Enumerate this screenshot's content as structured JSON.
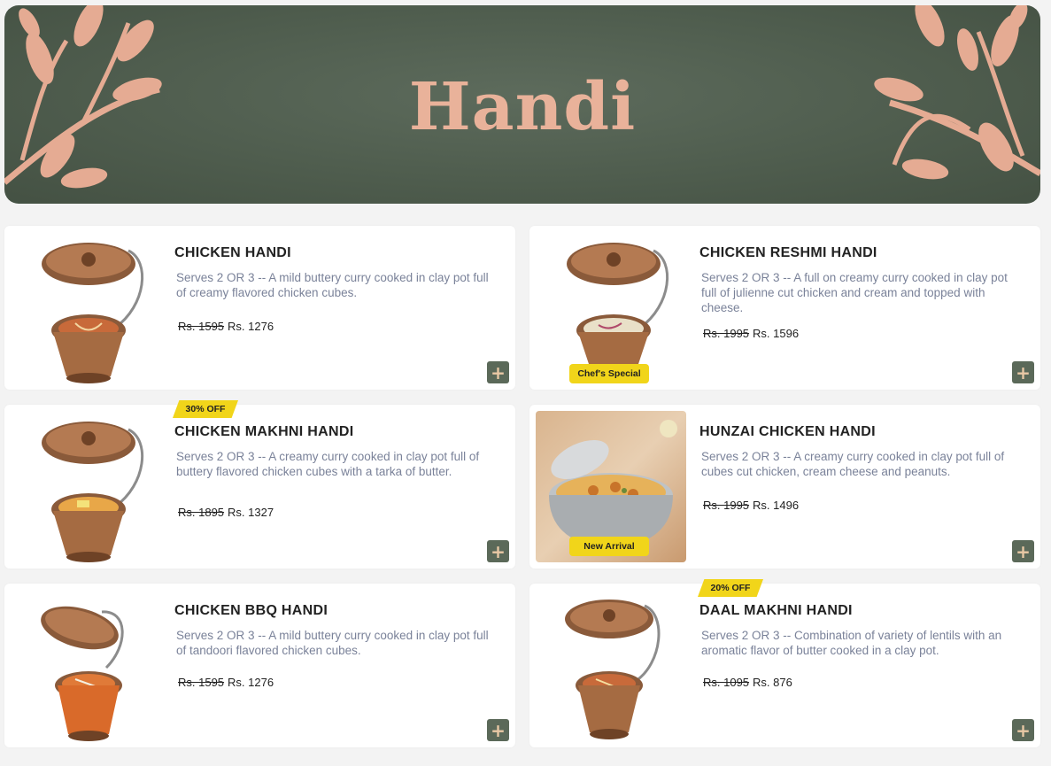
{
  "banner": {
    "title": "Handi",
    "title_color": "#e9b29a",
    "leaf_color": "#e5ab93"
  },
  "colors": {
    "accent": "#5b6959",
    "badge": "#f1d51a"
  },
  "items": [
    {
      "name": "CHICKEN HANDI",
      "description": "Serves 2 OR 3 -- A mild buttery curry cooked in clay pot full of creamy flavored chicken cubes.",
      "old_price": "Rs. 1595",
      "price": "Rs. 1276",
      "add_icon": "plus-icon"
    },
    {
      "name": "CHICKEN RESHMI HANDI",
      "description": "Serves 2 OR 3 -- A full on creamy curry cooked in clay pot full of julienne cut chicken and cream and topped with cheese.",
      "old_price": "Rs. 1995",
      "price": "Rs. 1596",
      "badge": "Chef's Special",
      "add_icon": "plus-icon"
    },
    {
      "name": "CHICKEN MAKHNI HANDI",
      "description": "Serves 2 OR 3 -- A creamy curry cooked in clay pot full of buttery flavored chicken cubes with a tarka of butter.",
      "old_price": "Rs. 1895",
      "price": "Rs. 1327",
      "discount": "30% OFF",
      "add_icon": "plus-icon"
    },
    {
      "name": "HUNZAI CHICKEN HANDI",
      "description": "Serves 2 OR 3 -- A creamy curry cooked in clay pot full of cubes cut chicken, cream cheese and peanuts.",
      "old_price": "Rs. 1995",
      "price": "Rs. 1496",
      "badge": "New Arrival",
      "add_icon": "plus-icon"
    },
    {
      "name": "CHICKEN BBQ HANDI",
      "description": "Serves 2 OR 3 -- A mild buttery curry cooked in clay pot full of tandoori flavored chicken cubes.",
      "old_price": "Rs. 1595",
      "price": "Rs. 1276",
      "add_icon": "plus-icon"
    },
    {
      "name": "DAAL MAKHNI HANDI",
      "description": "Serves 2 OR 3 -- Combination of variety of lentils with an aromatic flavor of butter cooked in a clay pot.",
      "old_price": "Rs. 1095",
      "price": "Rs. 876",
      "discount": "20% OFF",
      "add_icon": "plus-icon"
    }
  ]
}
